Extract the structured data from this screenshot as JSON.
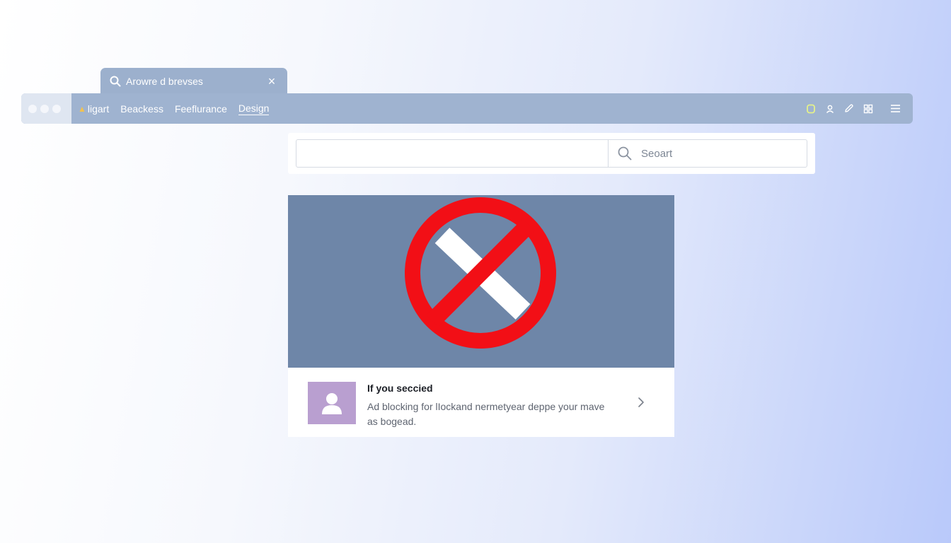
{
  "tab": {
    "title": "Arowre d brevses",
    "close_glyph": "×"
  },
  "toolbar": {
    "nav_items": [
      {
        "label": "ligart",
        "icon": "bell-icon",
        "icon_glyph": "▲"
      },
      {
        "label": "Beackess"
      },
      {
        "label": "Feeflurance"
      },
      {
        "label": "Design",
        "active": true
      }
    ],
    "tools": [
      "extension-icon",
      "account-icon",
      "pen-icon",
      "grid-icon",
      "hamburger-menu-icon"
    ]
  },
  "search": {
    "value": "",
    "placeholder": "Seoart"
  },
  "ad": {
    "banner_icon": "blocked-icon",
    "title": "If you seccied",
    "description": "Ad blocking for lIockand nermetyear deppe your mave as bogead.",
    "avatar_icon": "user-placeholder-icon"
  },
  "colors": {
    "toolbar": "#9fb3d0",
    "tab": "#9cb0cd",
    "banner": "#6e86a8",
    "block_red": "#f20f16",
    "avatar": "#b99fd0"
  }
}
